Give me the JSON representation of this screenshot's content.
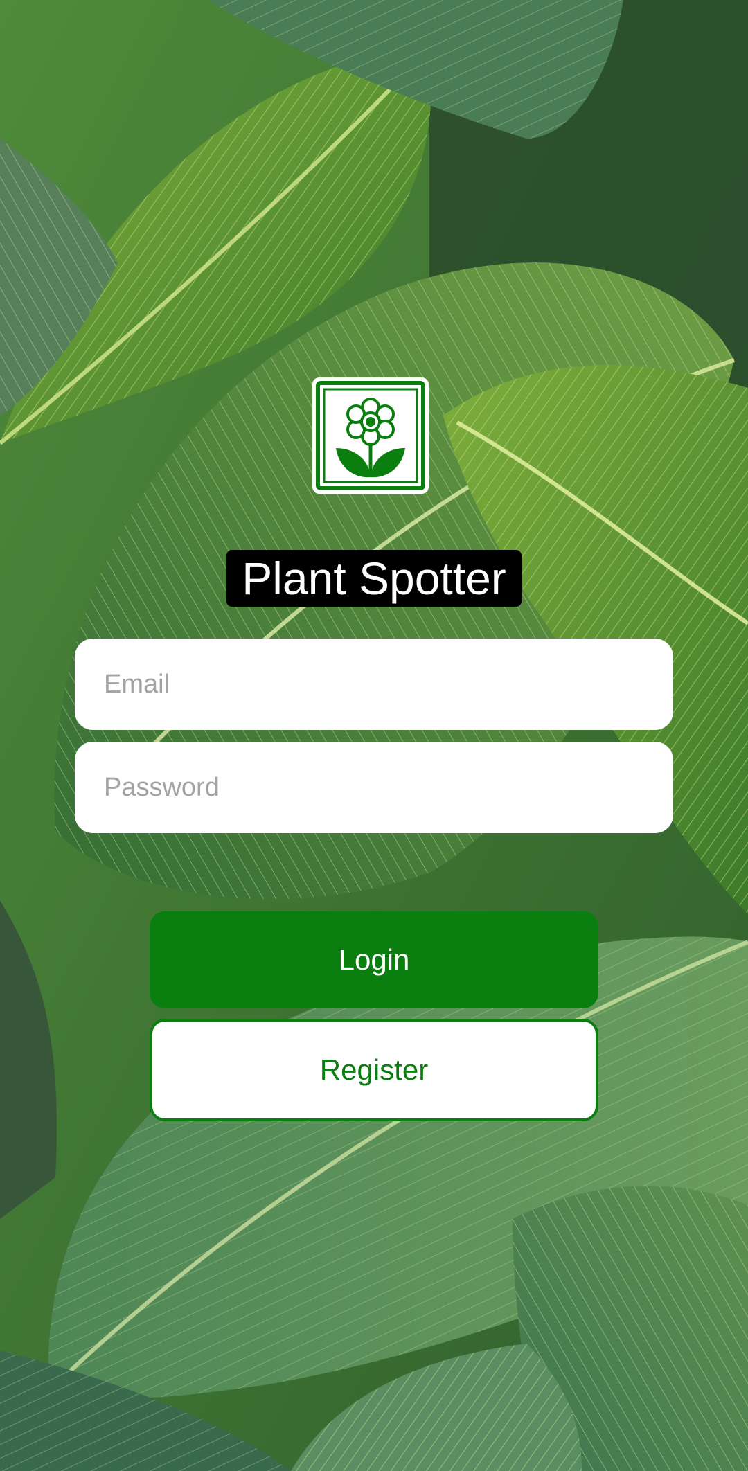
{
  "app": {
    "title": "Plant Spotter"
  },
  "logo": {
    "icon": "flower-icon"
  },
  "form": {
    "email_placeholder": "Email",
    "email_value": "",
    "password_placeholder": "Password",
    "password_value": ""
  },
  "actions": {
    "login_label": "Login",
    "register_label": "Register"
  },
  "colors": {
    "accent": "#0a7f10",
    "title_bg": "#000000",
    "field_bg": "#ffffff",
    "placeholder": "#a3a3a3"
  }
}
